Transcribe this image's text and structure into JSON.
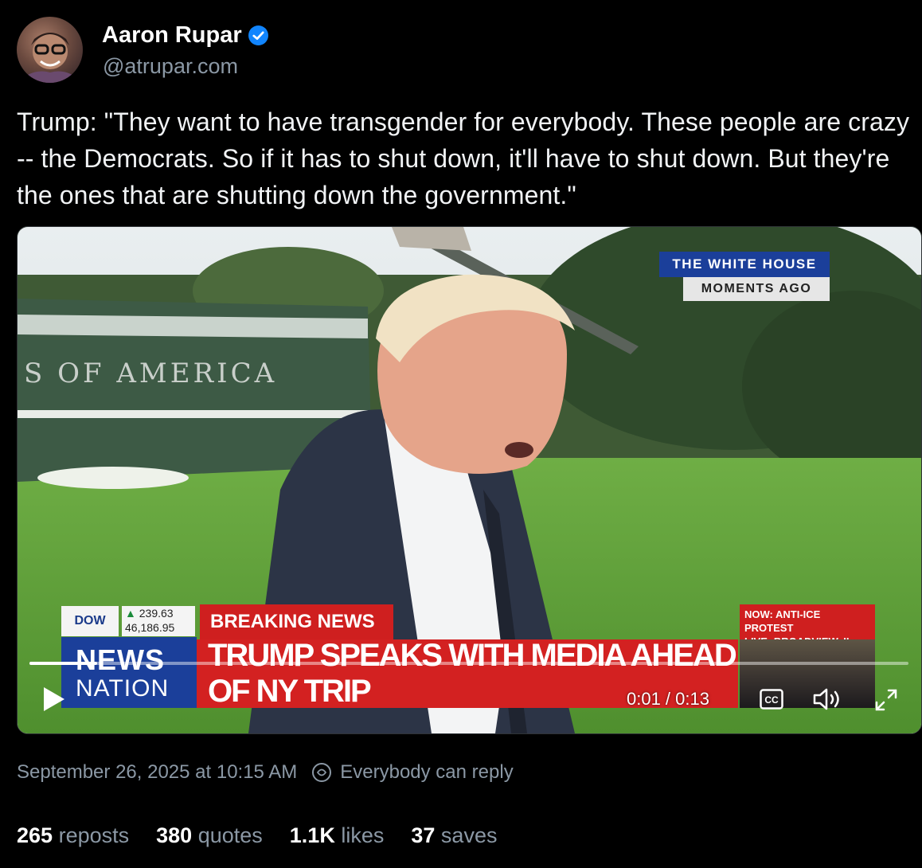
{
  "author": {
    "display_name": "Aaron Rupar",
    "handle": "@atrupar.com",
    "verified": true
  },
  "post": {
    "text": "Trump: \"They want to have transgender for everybody. These people are crazy -- the Democrats. So if it has to shut down, it'll have to shut down. But they're the ones that are shutting down the government.\""
  },
  "video": {
    "bug_location": "THE WHITE HOUSE",
    "bug_time": "MOMENTS AGO",
    "ticker_symbol": "DOW",
    "ticker_change": "239.63",
    "ticker_value": "46,186.95",
    "breaking_label": "BREAKING NEWS",
    "network_line1": "NEWS",
    "network_line2": "NATION",
    "headline": "TRUMP SPEAKS WITH MEDIA AHEAD OF NY TRIP",
    "side_label_line1": "NOW: ANTI-ICE PROTEST",
    "side_label_line2": "LIVE: BROADVIEW, IL",
    "helicopter_text": "S OF AMERICA",
    "time_display": "0:01 / 0:13",
    "progress_fraction": 0.077,
    "cc_label": "CC"
  },
  "meta": {
    "timestamp": "September 26, 2025 at 10:15 AM",
    "reply_setting": "Everybody can reply"
  },
  "stats": [
    {
      "count": "265",
      "label": "reposts"
    },
    {
      "count": "380",
      "label": "quotes"
    },
    {
      "count": "1.1K",
      "label": "likes"
    },
    {
      "count": "37",
      "label": "saves"
    }
  ],
  "colors": {
    "background": "#000000",
    "verified_blue": "#1185fe",
    "muted_text": "#8b98a5",
    "breaking_red": "#d32121",
    "network_blue": "#1b3f9a"
  },
  "icons": [
    "verified-badge-icon",
    "play-icon",
    "closed-captions-icon",
    "volume-icon",
    "fullscreen-icon",
    "reply-settings-icon"
  ]
}
